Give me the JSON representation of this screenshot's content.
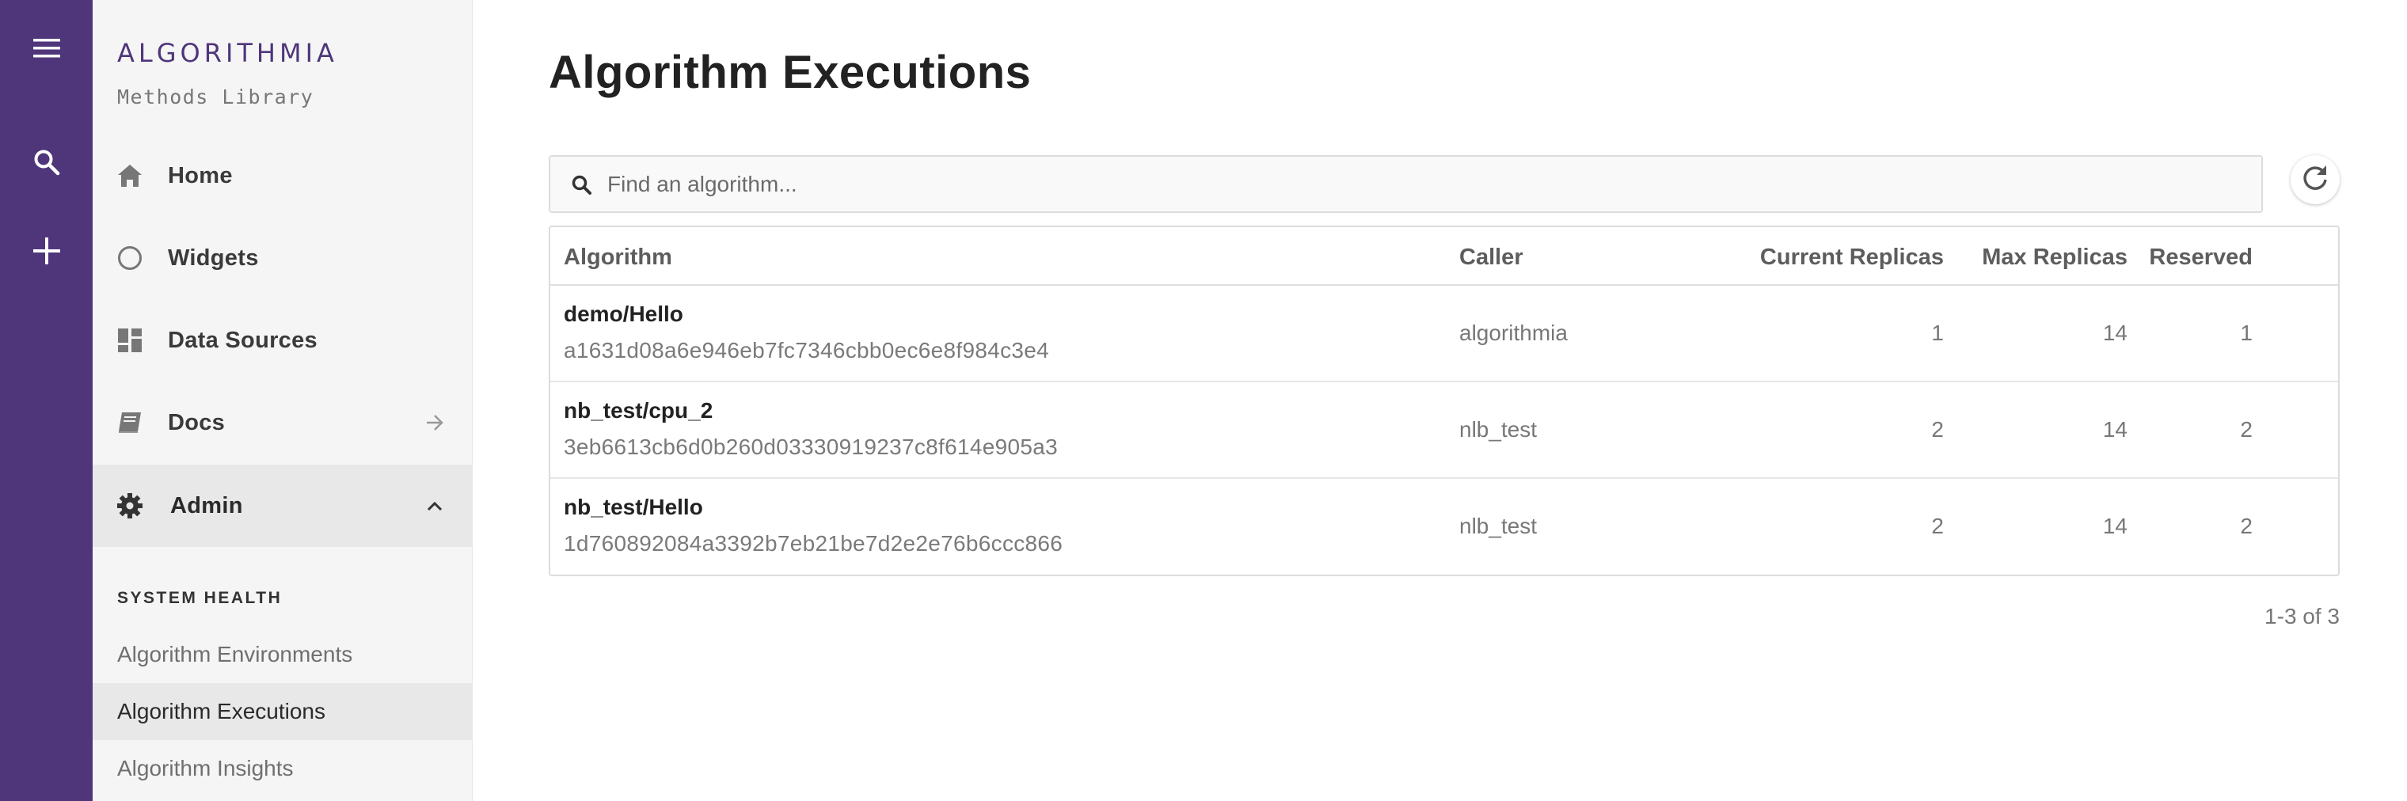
{
  "rail": {
    "icons": [
      "menu-icon",
      "search-icon",
      "plus-icon"
    ],
    "color": "#4f367a"
  },
  "sidebar": {
    "logo": "ALGORITHMIA",
    "subtitle": "Methods Library",
    "items": [
      {
        "label": "Home",
        "icon": "home-icon"
      },
      {
        "label": "Widgets",
        "icon": "circle-icon"
      },
      {
        "label": "Data Sources",
        "icon": "dashboard-icon"
      },
      {
        "label": "Docs",
        "icon": "book-icon",
        "trail": "arrow-right-icon"
      },
      {
        "label": "Admin",
        "icon": "gear-icon",
        "trail": "chevron-up-icon",
        "expanded": true
      }
    ],
    "section_title": "SYSTEM HEALTH",
    "sub_items": [
      {
        "label": "Algorithm Environments"
      },
      {
        "label": "Algorithm Executions",
        "active": true
      },
      {
        "label": "Algorithm Insights"
      }
    ]
  },
  "main": {
    "title": "Algorithm Executions",
    "search": {
      "placeholder": "Find an algorithm...",
      "value": ""
    },
    "table": {
      "columns": [
        "Algorithm",
        "Caller",
        "Current Replicas",
        "Max Replicas",
        "Reserved"
      ],
      "rows": [
        {
          "name": "demo/Hello",
          "hash": "a1631d08a6e946eb7fc7346cbb0ec6e8f984c3e4",
          "caller": "algorithmia",
          "current": "1",
          "max": "14",
          "reserved": "1"
        },
        {
          "name": "nb_test/cpu_2",
          "hash": "3eb6613cb6d0b260d03330919237c8f614e905a3",
          "caller": "nlb_test",
          "current": "2",
          "max": "14",
          "reserved": "2"
        },
        {
          "name": "nb_test/Hello",
          "hash": "1d760892084a3392b7eb21be7d2e2e76b6ccc866",
          "caller": "nlb_test",
          "current": "2",
          "max": "14",
          "reserved": "2"
        }
      ]
    },
    "pagination": "1-3 of 3"
  }
}
